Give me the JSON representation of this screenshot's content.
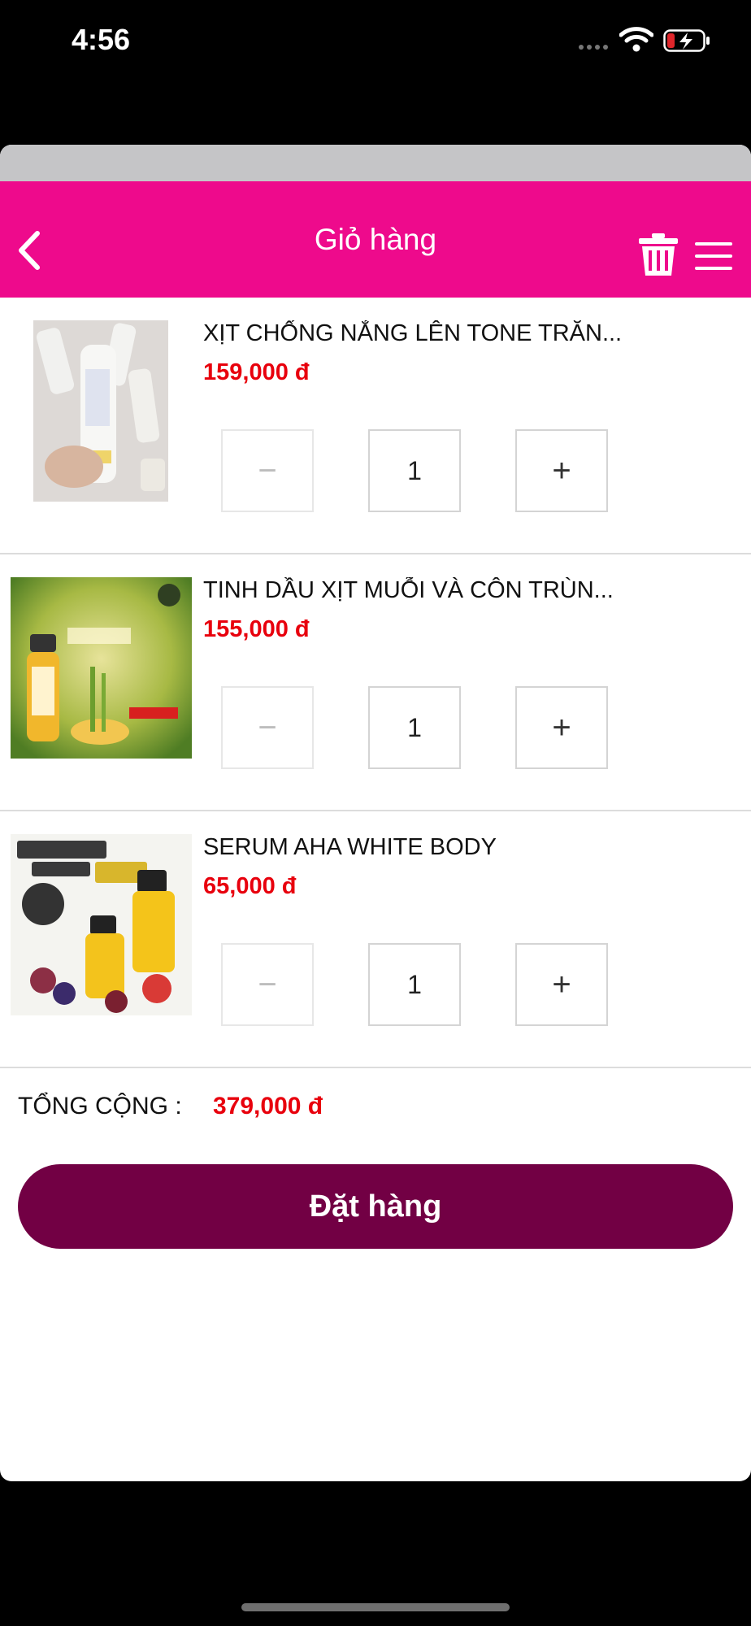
{
  "status_bar": {
    "time": "4:56"
  },
  "header": {
    "title": "Giỏ hàng"
  },
  "colors": {
    "header_bg": "#ee0a8c",
    "price": "#e8000d",
    "order_button_bg": "#720044"
  },
  "icons": {
    "back": "chevron-left-icon",
    "delete_all": "trash-icon",
    "menu": "hamburger-menu-icon",
    "decrease": "minus-icon",
    "increase": "plus-icon"
  },
  "cart": {
    "items": [
      {
        "name": "XỊT CHỐNG NẮNG LÊN TONE TRĂN...",
        "price": "159,000 đ",
        "quantity": "1",
        "decrease_label": "−",
        "increase_label": "+"
      },
      {
        "name": "TINH DẦU XỊT MUỖI VÀ CÔN TRÙN...",
        "price": "155,000 đ",
        "quantity": "1",
        "decrease_label": "−",
        "increase_label": "+"
      },
      {
        "name": "SERUM AHA WHITE BODY",
        "price": "65,000 đ",
        "quantity": "1",
        "decrease_label": "−",
        "increase_label": "+"
      }
    ]
  },
  "summary": {
    "total_label": "TỔNG CỘNG :",
    "total_value": "379,000 đ"
  },
  "order_button_label": "Đặt hàng"
}
